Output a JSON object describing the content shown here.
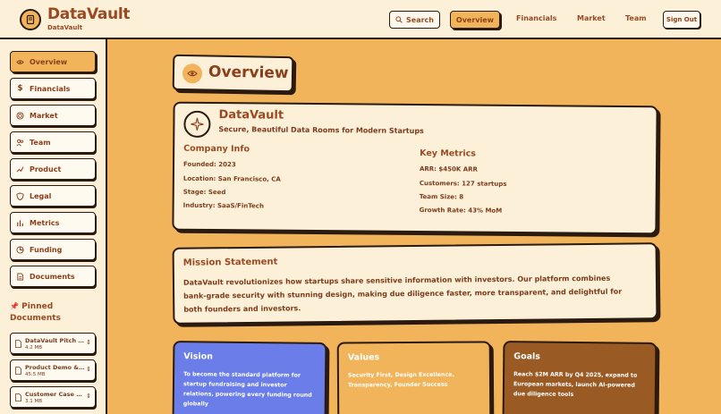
{
  "header": {
    "brand": "DataVault",
    "brand_sub": "DataVault",
    "search_label": "Search",
    "active_nav": "Overview",
    "nav": [
      "Financials",
      "Market",
      "Team"
    ],
    "signout_label": "Sign Out"
  },
  "sidebar": {
    "items": [
      {
        "label": "Overview",
        "icon": "eye-icon"
      },
      {
        "label": "Financials",
        "icon": "dollar-icon"
      },
      {
        "label": "Market",
        "icon": "target-icon"
      },
      {
        "label": "Team",
        "icon": "users-icon"
      },
      {
        "label": "Product",
        "icon": "trending-up-icon"
      },
      {
        "label": "Legal",
        "icon": "shield-icon"
      },
      {
        "label": "Metrics",
        "icon": "bar-chart-icon"
      },
      {
        "label": "Funding",
        "icon": "pie-chart-icon"
      },
      {
        "label": "Documents",
        "icon": "file-icon"
      }
    ],
    "pinned_title": "Pinned Documents",
    "pinned": [
      {
        "name": "DataVault Pitch Deck",
        "size": "4.2 MB"
      },
      {
        "name": "Product Demo & Roadmap",
        "size": "45.5 MB"
      },
      {
        "name": "Customer Case Studies",
        "size": "3.1 MB"
      }
    ]
  },
  "page": {
    "title": "Overview",
    "company": {
      "name": "DataVault",
      "tagline": "Secure, Beautiful Data Rooms for Modern Startups",
      "info_title": "Company Info",
      "info": [
        "Founded: 2023",
        "Location: San Francisco, CA",
        "Stage: Seed",
        "Industry: SaaS/FinTech"
      ],
      "metrics_title": "Key Metrics",
      "metrics": [
        "ARR: $450K ARR",
        "Customers: 127 startups",
        "Team Size: 8",
        "Growth Rate: 43% MoM"
      ]
    },
    "mission": {
      "title": "Mission Statement",
      "text": "DataVault revolutionizes how startups share sensitive information with investors. Our platform combines bank-grade security with stunning design, making due diligence faster, more transparent, and delightful for both founders and investors."
    },
    "vision": {
      "title": "Vision",
      "text": "To become the standard platform for startup fundraising and investor relations, powering every funding round globally"
    },
    "values": {
      "title": "Values",
      "text": "Security First, Design Excellence, Transparency, Founder Success"
    },
    "goals": {
      "title": "Goals",
      "text": "Reach $2M ARR by Q4 2025, expand to European markets, launch AI-powered due diligence tools"
    }
  },
  "colors": {
    "background": "#f1b45a",
    "surface": "#fdf0d8",
    "text": "#7a3b1c",
    "vision_card": "#6a7de8",
    "goals_card": "#9a5a24"
  }
}
